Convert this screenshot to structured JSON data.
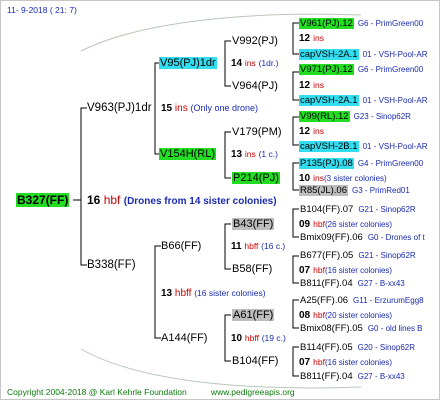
{
  "header": {
    "date": "11-  9-2018 (  21:  7)"
  },
  "footer": {
    "copyright": "Copyright 2004-2018 @ Karl Kehrle Foundation",
    "site": "www.pedigreeapis.org"
  },
  "root": {
    "id": "B327(FF)",
    "gen_num": "16",
    "gen_suffix": "hbf",
    "note": "(Drones from 14 sister colonies)"
  },
  "nodes": {
    "p1": {
      "id": "V963(PJ)1dr",
      "num": "15",
      "suf": "ins",
      "note": "(Only one drone)"
    },
    "p2": {
      "id": "B338(FF)",
      "num": "13",
      "suf": "hbff",
      "note": "(16 sister colonies)"
    },
    "g1": {
      "id": "V95(PJ)1dr",
      "num": "14",
      "suf": "ins",
      "note": "(1dr.)"
    },
    "g2": {
      "id": "V154H(RL)",
      "num": "13",
      "suf": "ins",
      "note": "(1 c.)"
    },
    "g3": {
      "id": "B66(FF)",
      "num": "11",
      "suf": "hbff",
      "note": "(16 c.)"
    },
    "g4": {
      "id": "A144(FF)",
      "num": "10",
      "suf": "hbff",
      "note": "(19 c.)"
    },
    "gg1": {
      "id": "V992(PJ)"
    },
    "gg2": {
      "id": "V964(PJ)"
    },
    "gg3": {
      "id": "V179(PM)"
    },
    "gg4": {
      "id": "P214(PJ)"
    },
    "gg5": {
      "id": "B43(FF)"
    },
    "gg6": {
      "id": "B58(FF)"
    },
    "gg7": {
      "id": "A61(FF)"
    },
    "gg8": {
      "id": "B104(FF)"
    }
  },
  "leaves": [
    {
      "id": "V961(PJ).12",
      "info": "G6 - PrimGreen00"
    },
    {
      "num": "12",
      "suf": "ins"
    },
    {
      "id": "capVSH-2A.1",
      "info": "01 - VSH-Pool-AR"
    },
    {
      "id": "V971(PJ).12",
      "info": "G6 - PrimGreen00"
    },
    {
      "num": "12",
      "suf": "ins"
    },
    {
      "id": "capVSH-2A.1",
      "info": "01 - VSH-Pool-AR"
    },
    {
      "id": "V99(RL).12",
      "info": "G23 - Sinop62R"
    },
    {
      "num": "12",
      "suf": "ins"
    },
    {
      "id": "capVSH-2B.1",
      "info": "01 - VSH-Pool-AR"
    },
    {
      "id": "P135(PJ).08",
      "info": "G4 - PrimGreen00"
    },
    {
      "num": "10",
      "suf": "ins",
      "note": "(3 sister colonies)"
    },
    {
      "id": "R85(JL).06",
      "info": "G3 - PrimRed01"
    },
    {
      "id": "B104(FF).07",
      "info": "G21 - Sinop62R"
    },
    {
      "num": "09",
      "suf": "hbf",
      "note": "(26 sister colonies)"
    },
    {
      "id": "Bmix09(FF).06",
      "info": "G0 - Drones of t"
    },
    {
      "id": "B677(FF).05",
      "info": "G21 - Sinop62R"
    },
    {
      "num": "07",
      "suf": "hbf",
      "note": "(16 sister colonies)"
    },
    {
      "id": "B811(FF).04",
      "info": "G27 - B-xx43"
    },
    {
      "id": "A25(FF).06",
      "info": "G11 - ErzurumEgg8"
    },
    {
      "num": "08",
      "suf": "hbf",
      "note": "(20 sister colonies)"
    },
    {
      "id": "Bmix08(FF).05",
      "info": "G0 - old lines B"
    },
    {
      "id": "B114(FF).05",
      "info": "G20 - Sinop62R"
    },
    {
      "num": "07",
      "suf": "hbf",
      "note": "(16 sister colonies)"
    },
    {
      "id": "B811(FF).04",
      "info": "G27 - B-xx43"
    }
  ]
}
